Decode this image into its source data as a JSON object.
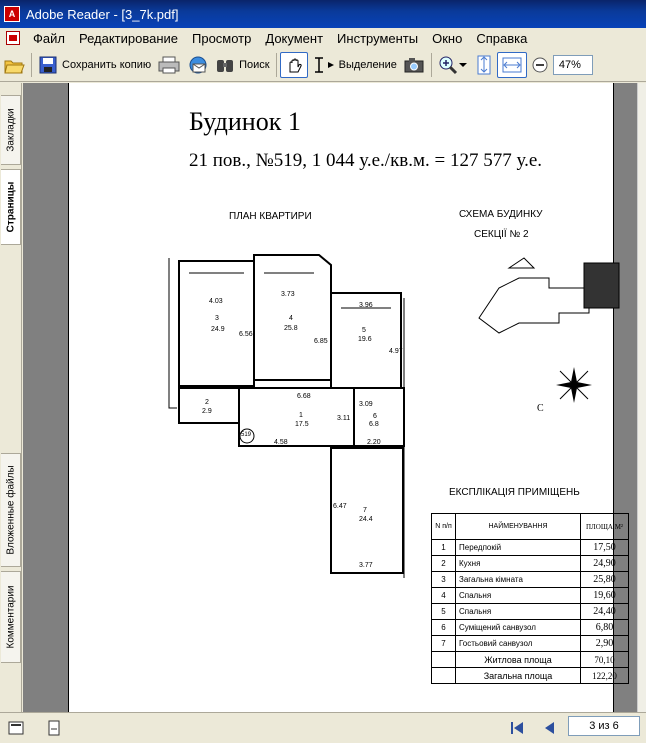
{
  "window": {
    "title": "Adobe Reader - [3_7k.pdf]"
  },
  "menu": {
    "items": [
      {
        "label": "Файл"
      },
      {
        "label": "Редактирование"
      },
      {
        "label": "Просмотр"
      },
      {
        "label": "Документ"
      },
      {
        "label": "Инструменты"
      },
      {
        "label": "Окно"
      },
      {
        "label": "Справка"
      }
    ]
  },
  "toolbar": {
    "save_copy_label": "Сохранить копию",
    "search_label": "Поиск",
    "select_label": "Выделение",
    "zoom_value": "47%"
  },
  "sidepanel": {
    "tabs": [
      "Закладки",
      "Страницы",
      "Вложенные файлы",
      "Комментарии"
    ]
  },
  "document": {
    "title": "Будинок 1",
    "subtitle": "21 пов., №519, 1 044 у.е./кв.м. = 127 577 у.е.",
    "plan_caption": "ПЛАН КВАРТИРИ",
    "scheme_caption_1": "СХЕМА БУДИНКУ",
    "scheme_caption_2": "СЕКЦІЇ № 2",
    "compass_label": "С",
    "apartment_no": "519",
    "rooms": {
      "r3_width": "4.03",
      "r3_no": "3",
      "r3_area": "24.9",
      "r3_height": "6.56",
      "r4_width": "3.73",
      "r4_no": "4",
      "r4_area": "25.8",
      "r4_height": "6.85",
      "r5_width": "3.96",
      "r5_no": "5",
      "r5_area": "19.6",
      "r5_height": "4.97",
      "r2_no": "2",
      "r2_area": "2.9",
      "r1_width": "6.68",
      "r1_no": "1",
      "r1_area": "17.5",
      "r1_height": "3.11",
      "r1_bottom": "4.58",
      "r6_no": "6",
      "r6_area": "6.8",
      "r6_height": "3.09",
      "r6_bottom": "2.20",
      "r7_no": "7",
      "r7_area": "24.4",
      "r7_height": "6.47",
      "r7_bottom": "3.77"
    },
    "explication_title": "ЕКСПЛІКАЦІЯ ПРИМІЩЕНЬ",
    "table_headers": {
      "num": "N п/п",
      "name": "НАЙМЕНУВАННЯ",
      "area": "ПЛОЩА М²"
    },
    "table_rows": [
      {
        "n": "1",
        "name": "Передпокій",
        "area": "17,50"
      },
      {
        "n": "2",
        "name": "Кухня",
        "area": "24,90"
      },
      {
        "n": "3",
        "name": "Загальна кімната",
        "area": "25,80"
      },
      {
        "n": "4",
        "name": "Спальня",
        "area": "19,60"
      },
      {
        "n": "5",
        "name": "Спальня",
        "area": "24,40"
      },
      {
        "n": "6",
        "name": "Суміщений санвузол",
        "area": "6,80"
      },
      {
        "n": "7",
        "name": "Гостьовий санвузол",
        "area": "2,90"
      }
    ],
    "living_area_label": "Житлова площа",
    "living_area_value": "70,10",
    "total_area_label": "Загальна площа",
    "total_area_value": "122,20"
  },
  "status": {
    "page_indicator": "3 из 6"
  }
}
